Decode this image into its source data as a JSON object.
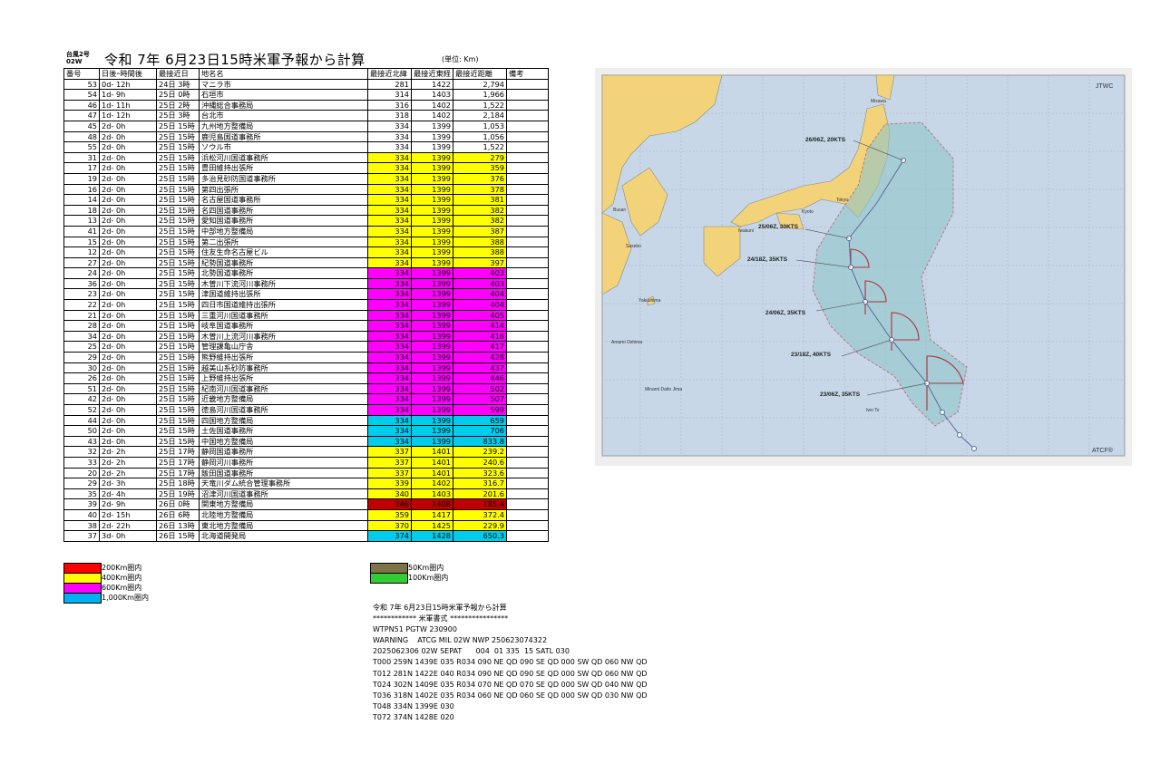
{
  "header": {
    "typhoon_tag_line1": "台風2号",
    "typhoon_tag_line2": "02W",
    "title": "令和 7年 6月23日15時米軍予報から計算",
    "unit": "(単位: Km)"
  },
  "table": {
    "columns": [
      "番号",
      "日後ｰ時間後",
      "最接近日",
      "地名名",
      "最接近北緯",
      "最接近東経",
      "最接近距離",
      "備考"
    ],
    "rows": [
      {
        "no": "53",
        "after": "0d- 12h",
        "date": "24日  3時",
        "name": "マニラ市",
        "lat": "281",
        "lon": "1422",
        "dist": "2,794",
        "color": ""
      },
      {
        "no": "54",
        "after": "1d-  9h",
        "date": "25日  0時",
        "name": "石垣市",
        "lat": "314",
        "lon": "1403",
        "dist": "1,966",
        "color": ""
      },
      {
        "no": "46",
        "after": "1d- 11h",
        "date": "25日  2時",
        "name": "沖縄総合事務局",
        "lat": "316",
        "lon": "1402",
        "dist": "1,522",
        "color": ""
      },
      {
        "no": "47",
        "after": "1d- 12h",
        "date": "25日  3時",
        "name": "台北市",
        "lat": "318",
        "lon": "1402",
        "dist": "2,184",
        "color": ""
      },
      {
        "no": "45",
        "after": "2d-  0h",
        "date": "25日 15時",
        "name": "九州地方整備局",
        "lat": "334",
        "lon": "1399",
        "dist": "1,053",
        "color": ""
      },
      {
        "no": "48",
        "after": "2d-  0h",
        "date": "25日 15時",
        "name": "鹿児島国道事務所",
        "lat": "334",
        "lon": "1399",
        "dist": "1,056",
        "color": ""
      },
      {
        "no": "55",
        "after": "2d-  0h",
        "date": "25日 15時",
        "name": "ソウル市",
        "lat": "334",
        "lon": "1399",
        "dist": "1,522",
        "color": ""
      },
      {
        "no": "31",
        "after": "2d-  0h",
        "date": "25日 15時",
        "name": "浜松河川国道事務所",
        "lat": "334",
        "lon": "1399",
        "dist": "279",
        "color": "yellow"
      },
      {
        "no": "17",
        "after": "2d-  0h",
        "date": "25日 15時",
        "name": "豊田維持出張所",
        "lat": "334",
        "lon": "1399",
        "dist": "359",
        "color": "yellow"
      },
      {
        "no": "19",
        "after": "2d-  0h",
        "date": "25日 15時",
        "name": "多治見砂防国道事務所",
        "lat": "334",
        "lon": "1399",
        "dist": "376",
        "color": "yellow"
      },
      {
        "no": "16",
        "after": "2d-  0h",
        "date": "25日 15時",
        "name": "第四出張所",
        "lat": "334",
        "lon": "1399",
        "dist": "378",
        "color": "yellow"
      },
      {
        "no": "14",
        "after": "2d-  0h",
        "date": "25日 15時",
        "name": "名古屋国道事務所",
        "lat": "334",
        "lon": "1399",
        "dist": "381",
        "color": "yellow"
      },
      {
        "no": "18",
        "after": "2d-  0h",
        "date": "25日 15時",
        "name": "名四国道事務所",
        "lat": "334",
        "lon": "1399",
        "dist": "382",
        "color": "yellow"
      },
      {
        "no": "13",
        "after": "2d-  0h",
        "date": "25日 15時",
        "name": "愛知国道事務所",
        "lat": "334",
        "lon": "1399",
        "dist": "382",
        "color": "yellow"
      },
      {
        "no": "41",
        "after": "2d-  0h",
        "date": "25日 15時",
        "name": "中部地方整備局",
        "lat": "334",
        "lon": "1399",
        "dist": "387",
        "color": "yellow"
      },
      {
        "no": "15",
        "after": "2d-  0h",
        "date": "25日 15時",
        "name": "第二出張所",
        "lat": "334",
        "lon": "1399",
        "dist": "388",
        "color": "yellow"
      },
      {
        "no": "12",
        "after": "2d-  0h",
        "date": "25日 15時",
        "name": "住友生命名古屋ビル",
        "lat": "334",
        "lon": "1399",
        "dist": "388",
        "color": "yellow"
      },
      {
        "no": "27",
        "after": "2d-  0h",
        "date": "25日 15時",
        "name": "紀勢国道事務所",
        "lat": "334",
        "lon": "1399",
        "dist": "397",
        "color": "yellow"
      },
      {
        "no": "24",
        "after": "2d-  0h",
        "date": "25日 15時",
        "name": "北勢国道事務所",
        "lat": "334",
        "lon": "1399",
        "dist": "403",
        "color": "magenta"
      },
      {
        "no": "36",
        "after": "2d-  0h",
        "date": "25日 15時",
        "name": "木曽川下流河川事務所",
        "lat": "334",
        "lon": "1399",
        "dist": "403",
        "color": "magenta"
      },
      {
        "no": "23",
        "after": "2d-  0h",
        "date": "25日 15時",
        "name": "津国道維持出張所",
        "lat": "334",
        "lon": "1399",
        "dist": "404",
        "color": "magenta"
      },
      {
        "no": "22",
        "after": "2d-  0h",
        "date": "25日 15時",
        "name": "四日市国道維持出張所",
        "lat": "334",
        "lon": "1399",
        "dist": "404",
        "color": "magenta"
      },
      {
        "no": "21",
        "after": "2d-  0h",
        "date": "25日 15時",
        "name": "三重河川国道事務所",
        "lat": "334",
        "lon": "1399",
        "dist": "405",
        "color": "magenta"
      },
      {
        "no": "28",
        "after": "2d-  0h",
        "date": "25日 15時",
        "name": "岐阜国道事務所",
        "lat": "334",
        "lon": "1399",
        "dist": "414",
        "color": "magenta"
      },
      {
        "no": "34",
        "after": "2d-  0h",
        "date": "25日 15時",
        "name": "木曽川上流河川事務所",
        "lat": "334",
        "lon": "1399",
        "dist": "416",
        "color": "magenta"
      },
      {
        "no": "25",
        "after": "2d-  0h",
        "date": "25日 15時",
        "name": "管理課亀山庁舎",
        "lat": "334",
        "lon": "1399",
        "dist": "417",
        "color": "magenta"
      },
      {
        "no": "29",
        "after": "2d-  0h",
        "date": "25日 15時",
        "name": "熊野維持出張所",
        "lat": "334",
        "lon": "1399",
        "dist": "428",
        "color": "magenta"
      },
      {
        "no": "30",
        "after": "2d-  0h",
        "date": "25日 15時",
        "name": "越美山系砂防事務所",
        "lat": "334",
        "lon": "1399",
        "dist": "437",
        "color": "magenta"
      },
      {
        "no": "26",
        "after": "2d-  0h",
        "date": "25日 15時",
        "name": "上野維持出張所",
        "lat": "334",
        "lon": "1399",
        "dist": "446",
        "color": "magenta"
      },
      {
        "no": "51",
        "after": "2d-  0h",
        "date": "25日 15時",
        "name": "紀南河川国道事務所",
        "lat": "334",
        "lon": "1399",
        "dist": "502",
        "color": "magenta"
      },
      {
        "no": "42",
        "after": "2d-  0h",
        "date": "25日 15時",
        "name": "近畿地方整備局",
        "lat": "334",
        "lon": "1399",
        "dist": "507",
        "color": "magenta"
      },
      {
        "no": "52",
        "after": "2d-  0h",
        "date": "25日 15時",
        "name": "徳島河川国道事務所",
        "lat": "334",
        "lon": "1399",
        "dist": "599",
        "color": "magenta"
      },
      {
        "no": "44",
        "after": "2d-  0h",
        "date": "25日 15時",
        "name": "四国地方整備局",
        "lat": "334",
        "lon": "1399",
        "dist": "659",
        "color": "cyan"
      },
      {
        "no": "50",
        "after": "2d-  0h",
        "date": "25日 15時",
        "name": "土佐国道事務所",
        "lat": "334",
        "lon": "1399",
        "dist": "706",
        "color": "cyan"
      },
      {
        "no": "43",
        "after": "2d-  0h",
        "date": "25日 15時",
        "name": "中国地方整備局",
        "lat": "334",
        "lon": "1399",
        "dist": "833.8",
        "color": "cyan"
      },
      {
        "no": "32",
        "after": "2d-  2h",
        "date": "25日 17時",
        "name": "静岡国道事務所",
        "lat": "337",
        "lon": "1401",
        "dist": "239.2",
        "color": "yellow"
      },
      {
        "no": "33",
        "after": "2d-  2h",
        "date": "25日 17時",
        "name": "静岡河川事務所",
        "lat": "337",
        "lon": "1401",
        "dist": "240.6",
        "color": "yellow"
      },
      {
        "no": "20",
        "after": "2d-  2h",
        "date": "25日 17時",
        "name": "飯田国道事務所",
        "lat": "337",
        "lon": "1401",
        "dist": "323.6",
        "color": "yellow"
      },
      {
        "no": "29",
        "after": "2d-  3h",
        "date": "25日 18時",
        "name": "天竜川ダム統合管理事務所",
        "lat": "339",
        "lon": "1402",
        "dist": "316.7",
        "color": "yellow"
      },
      {
        "no": "35",
        "after": "2d-  4h",
        "date": "25日 19時",
        "name": "沼津河川国道事務所",
        "lat": "340",
        "lon": "1403",
        "dist": "201.6",
        "color": "yellow"
      },
      {
        "no": "39",
        "after": "2d-  9h",
        "date": "26日  0時",
        "name": "関東地方整備局",
        "lat": "346",
        "lon": "1408",
        "dist": "185.4",
        "color": "red"
      },
      {
        "no": "40",
        "after": "2d- 15h",
        "date": "26日  6時",
        "name": "北陸地方整備局",
        "lat": "359",
        "lon": "1417",
        "dist": "372.4",
        "color": "yellow"
      },
      {
        "no": "38",
        "after": "2d- 22h",
        "date": "26日 13時",
        "name": "東北地方整備局",
        "lat": "370",
        "lon": "1425",
        "dist": "229.9",
        "color": "yellow"
      },
      {
        "no": "37",
        "after": "3d-  0h",
        "date": "26日 15時",
        "name": "北海道開発局",
        "lat": "374",
        "lon": "1428",
        "dist": "650.3",
        "color": "cyan"
      }
    ]
  },
  "legend": [
    {
      "label": "200Km圏内",
      "color": "#ff0000"
    },
    {
      "label": "400Km圏内",
      "color": "#ffff00"
    },
    {
      "label": "600Km圏内",
      "color": "#ff00ff"
    },
    {
      "label": "1,000Km圏内",
      "color": "#00b0f0"
    },
    {
      "label": "50Km圏内",
      "color": "#7f7249"
    },
    {
      "label": "100Km圏内",
      "color": "#33cc33"
    }
  ],
  "message": {
    "lines": [
      "令和 7年 6月23日15時米軍予報から計算",
      "************ 米軍書式 ****************",
      "WTPN51 PGTW 230900",
      "WARNING    ATCG MIL 02W NWP 250623074322",
      "2025062306 02W SEPAT      004  01 335  15 SATL 030",
      "T000 259N 1439E 035 R034 090 NE QD 090 SE QD 000 SW QD 060 NW QD",
      "T012 281N 1422E 040 R034 090 NE QD 090 SE QD 000 SW QD 060 NW QD",
      "T024 302N 1409E 035 R034 070 NE QD 070 SE QD 000 SW QD 040 NW QD",
      "T036 318N 1402E 035 R034 060 NE QD 060 SE QD 000 SW QD 030 NW QD",
      "T048 334N 1399E 030",
      "T072 374N 1428E 020"
    ]
  },
  "map": {
    "brand_top": "JTWC",
    "brand_bottom": "ATCF®",
    "cities": [
      "Misawa",
      "Tokyo",
      "Kyoto",
      "Iwakuni",
      "Busan",
      "Sasebo",
      "Yakushima",
      "Amami Oshima",
      "Minami Daito Jima",
      "Iwo To"
    ],
    "forecast_labels": [
      "26/06Z, 20KTS",
      "25/06Z, 30KTS",
      "24/18Z, 35KTS",
      "24/06Z, 35KTS",
      "23/18Z, 40KTS",
      "23/06Z, 35KTS"
    ],
    "colors": {
      "ocean": "#c7d7e8",
      "land": "#f2d37a",
      "swath": "#8fc4c8",
      "wind": "#b0303a",
      "track": "#5a6a9a"
    }
  }
}
